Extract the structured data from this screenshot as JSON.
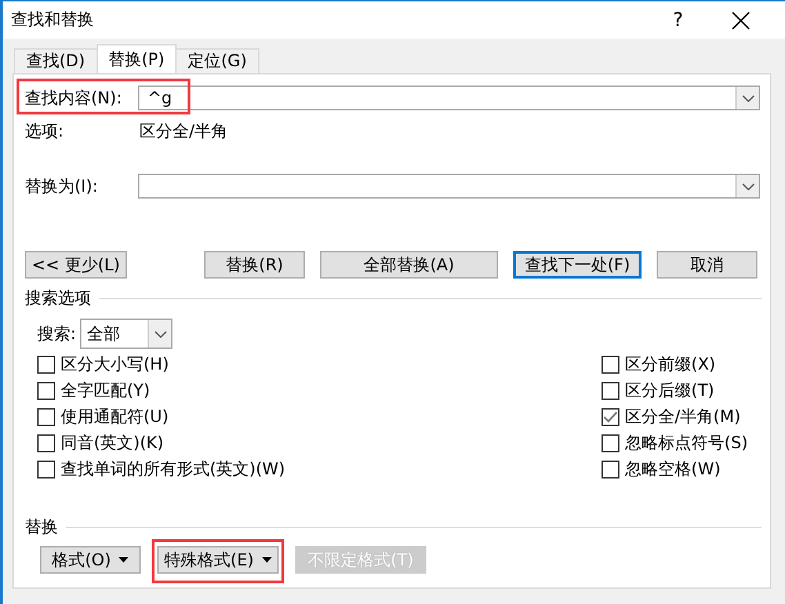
{
  "window": {
    "title": "查找和替换",
    "help": "?"
  },
  "tabs": [
    {
      "label": "查找(D)",
      "selected": false
    },
    {
      "label": "替换(P)",
      "selected": true
    },
    {
      "label": "定位(G)",
      "selected": false
    }
  ],
  "find": {
    "label": "查找内容(N):",
    "value": "^g",
    "highlighted": true
  },
  "options": {
    "label": "选项:",
    "value": "区分全/半角"
  },
  "replace": {
    "label": "替换为(I):"
  },
  "buttons": [
    {
      "label": "<< 更少(L)",
      "focused": false
    },
    {
      "label": "替换(R)",
      "focused": false
    },
    {
      "label": "全部替换(A)",
      "focused": false
    },
    {
      "label": "查找下一处(F)",
      "focused": true
    },
    {
      "label": "取消",
      "focused": false
    }
  ],
  "search_options": {
    "title": "搜索选项",
    "search_label": "搜索:",
    "search_scope": "全部",
    "left": [
      {
        "label": "区分大小写(H)",
        "checked": false
      },
      {
        "label": "全字匹配(Y)",
        "checked": false
      },
      {
        "label": "使用通配符(U)",
        "checked": false
      },
      {
        "label": "同音(英文)(K)",
        "checked": false
      },
      {
        "label": "查找单词的所有形式(英文)(W)",
        "checked": false
      }
    ],
    "right": [
      {
        "label": "区分前缀(X)",
        "checked": false
      },
      {
        "label": "区分后缀(T)",
        "checked": false
      },
      {
        "label": "区分全/半角(M)",
        "checked": true
      },
      {
        "label": "忽略标点符号(S)",
        "checked": false
      },
      {
        "label": "忽略空格(W)",
        "checked": false
      }
    ]
  },
  "replace_section": {
    "title": "替换",
    "buttons": [
      {
        "label": "格式(O)",
        "dropdown": true,
        "disabled": false,
        "highlighted": false
      },
      {
        "label": "特殊格式(E)",
        "dropdown": true,
        "disabled": false,
        "highlighted": true
      },
      {
        "label": "不限定格式(T)",
        "dropdown": false,
        "disabled": true,
        "highlighted": false
      }
    ]
  }
}
